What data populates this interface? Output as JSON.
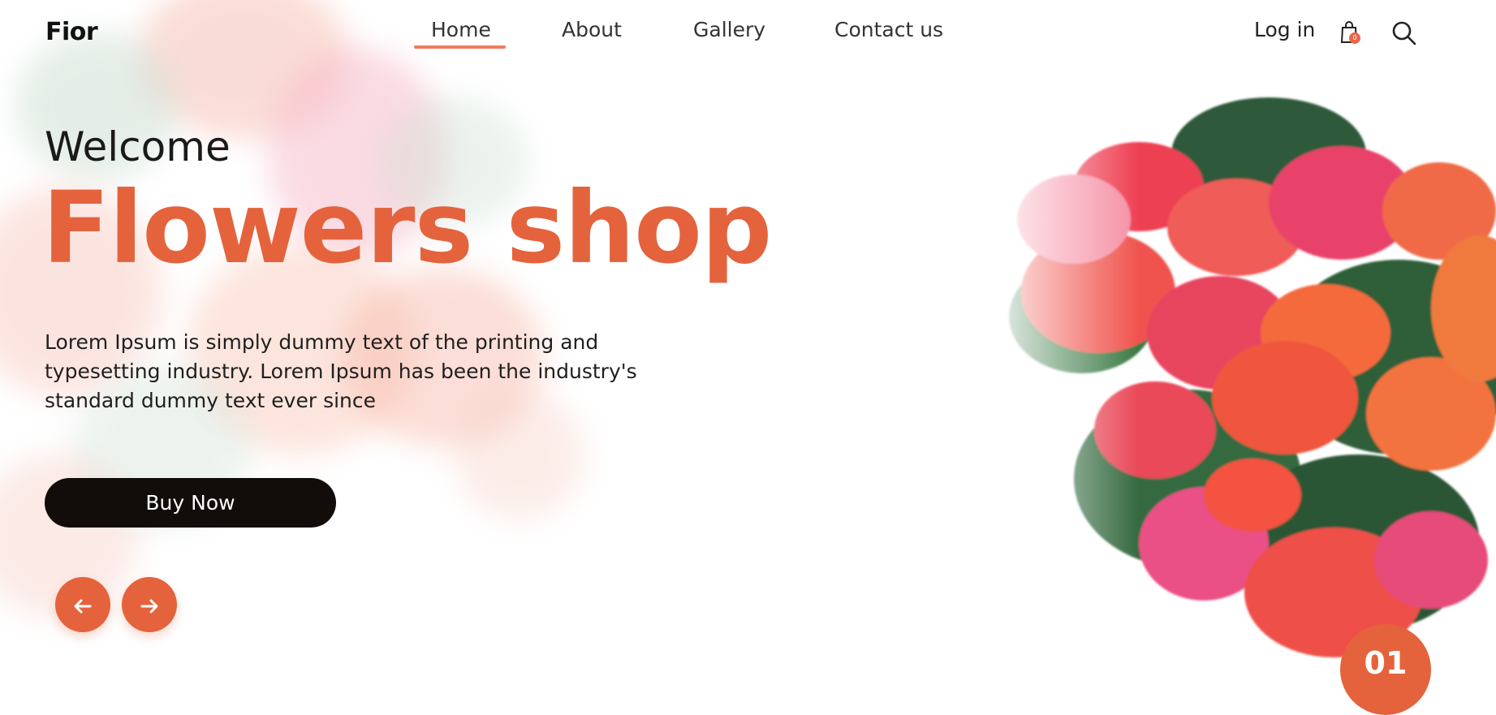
{
  "brand": {
    "logo": "Fior",
    "accent": "#e4633c",
    "dark": "#120c0a"
  },
  "nav": {
    "items": [
      "Home",
      "About",
      "Gallery",
      "Contact us"
    ],
    "active": "Home"
  },
  "header_actions": {
    "login": "Log in",
    "cart_icon": "shopping-bag-icon",
    "cart_count": "0",
    "search_icon": "search-icon"
  },
  "hero": {
    "welcome": "Welcome",
    "headline": "Flowers shop",
    "description": "Lorem Ipsum is simply dummy text of the printing and typesetting industry. Lorem Ipsum has been the industry's standard dummy text ever since",
    "cta": "Buy Now",
    "prev_icon": "arrow-left-icon",
    "next_icon": "arrow-right-icon",
    "slide_number": "01"
  }
}
